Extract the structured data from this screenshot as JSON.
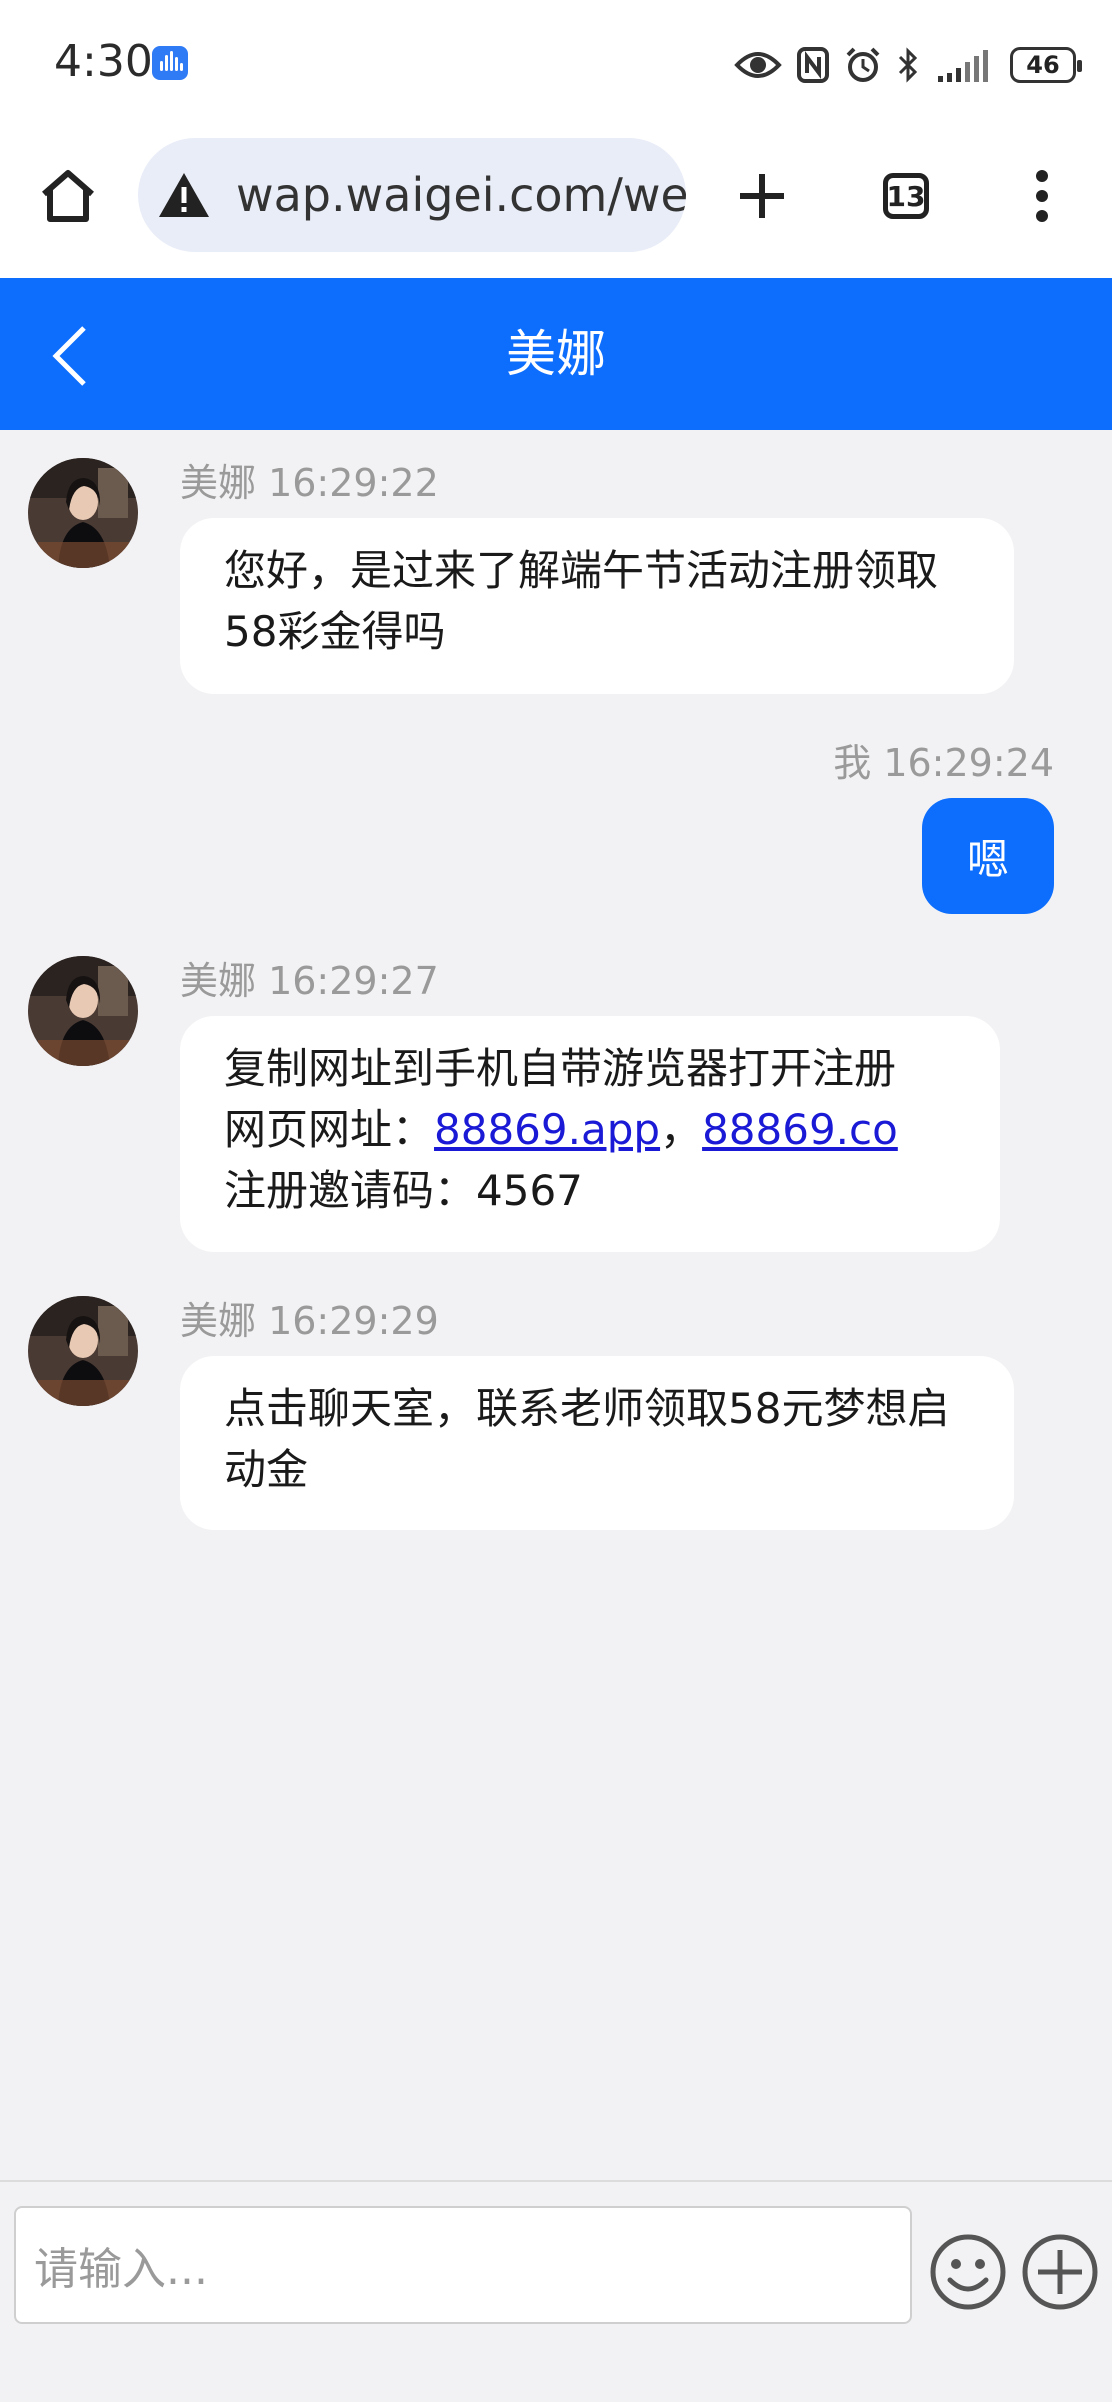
{
  "status_bar": {
    "time": "4:30",
    "battery": "46",
    "icons": [
      "voice-app-icon",
      "eye-icon",
      "nfc-icon",
      "alarm-icon",
      "bluetooth-icon",
      "signal-icon",
      "battery-icon"
    ]
  },
  "browser": {
    "url": "wap.waigei.com/web",
    "tab_count": "13",
    "icons": [
      "home-icon",
      "warning-icon",
      "new-tab-icon",
      "more-icon"
    ]
  },
  "header": {
    "title": "美娜"
  },
  "messages": [
    {
      "sender": "美娜",
      "time": "16:29:22",
      "meta": "美娜 16:29:22",
      "text": "您好，是过来了解端午节活动注册领取58彩金得吗"
    },
    {
      "sender": "我",
      "time": "16:29:24",
      "meta": "我 16:29:24",
      "text": "嗯"
    },
    {
      "sender": "美娜",
      "time": "16:29:27",
      "meta": "美娜 16:29:27",
      "line1": "复制网址到手机自带游览器打开注册",
      "line2_prefix": "网页网址：",
      "link1": "88869.app",
      "separator": "，",
      "link2": "88869.co",
      "line3": "注册邀请码：4567"
    },
    {
      "sender": "美娜",
      "time": "16:29:29",
      "meta": "美娜 16:29:29",
      "text": "点击聊天室，联系老师领取58元梦想启动金"
    }
  ],
  "input": {
    "placeholder": "请输入..."
  },
  "colors": {
    "accent": "#0d6efd",
    "background": "#f2f2f4",
    "bubble": "#ffffff",
    "meta_text": "#9a9a9a"
  }
}
